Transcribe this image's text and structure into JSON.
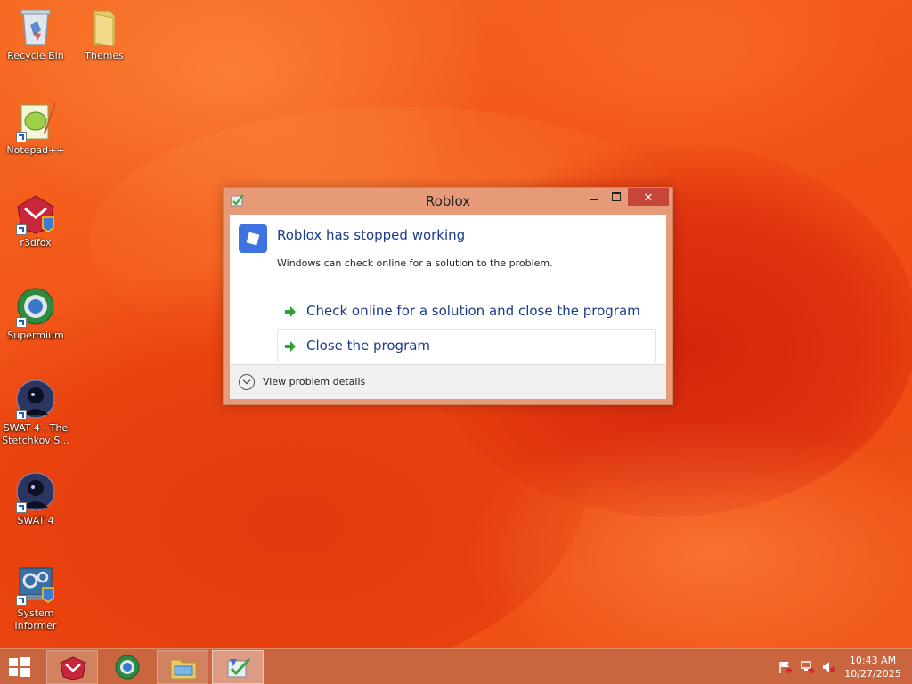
{
  "desktop": {
    "icons": [
      {
        "label": "Recycle Bin",
        "icon": "recycle-bin-icon"
      },
      {
        "label": "Themes",
        "icon": "folder-icon"
      },
      {
        "label": "Notepad++",
        "icon": "notepadpp-icon"
      },
      {
        "label": "r3dfox",
        "icon": "r3dfox-icon"
      },
      {
        "label": "Supermium",
        "icon": "supermium-icon"
      },
      {
        "label": "SWAT 4 - The Stetchkov S...",
        "icon": "swat4-icon"
      },
      {
        "label": "SWAT 4",
        "icon": "swat4-icon"
      },
      {
        "label": "System Informer",
        "icon": "system-informer-icon"
      }
    ]
  },
  "dialog": {
    "title": "Roblox",
    "main_instruction": "Roblox has stopped working",
    "sub_text": "Windows can check online for a solution to the problem.",
    "option_check_online": "Check online for a solution and close the program",
    "option_close": "Close the program",
    "details_toggle": "View problem details",
    "close_glyph": "✕"
  },
  "taskbar": {
    "apps": [
      "r3dfox",
      "Supermium",
      "File Explorer",
      "Problem Reporting"
    ],
    "time": "10:43 AM",
    "date": "10/27/2025"
  },
  "colors": {
    "accent_link": "#1b3c8c",
    "close_button": "#c7463c",
    "dialog_frame": "#e69a78",
    "taskbar": "#c9663f"
  }
}
